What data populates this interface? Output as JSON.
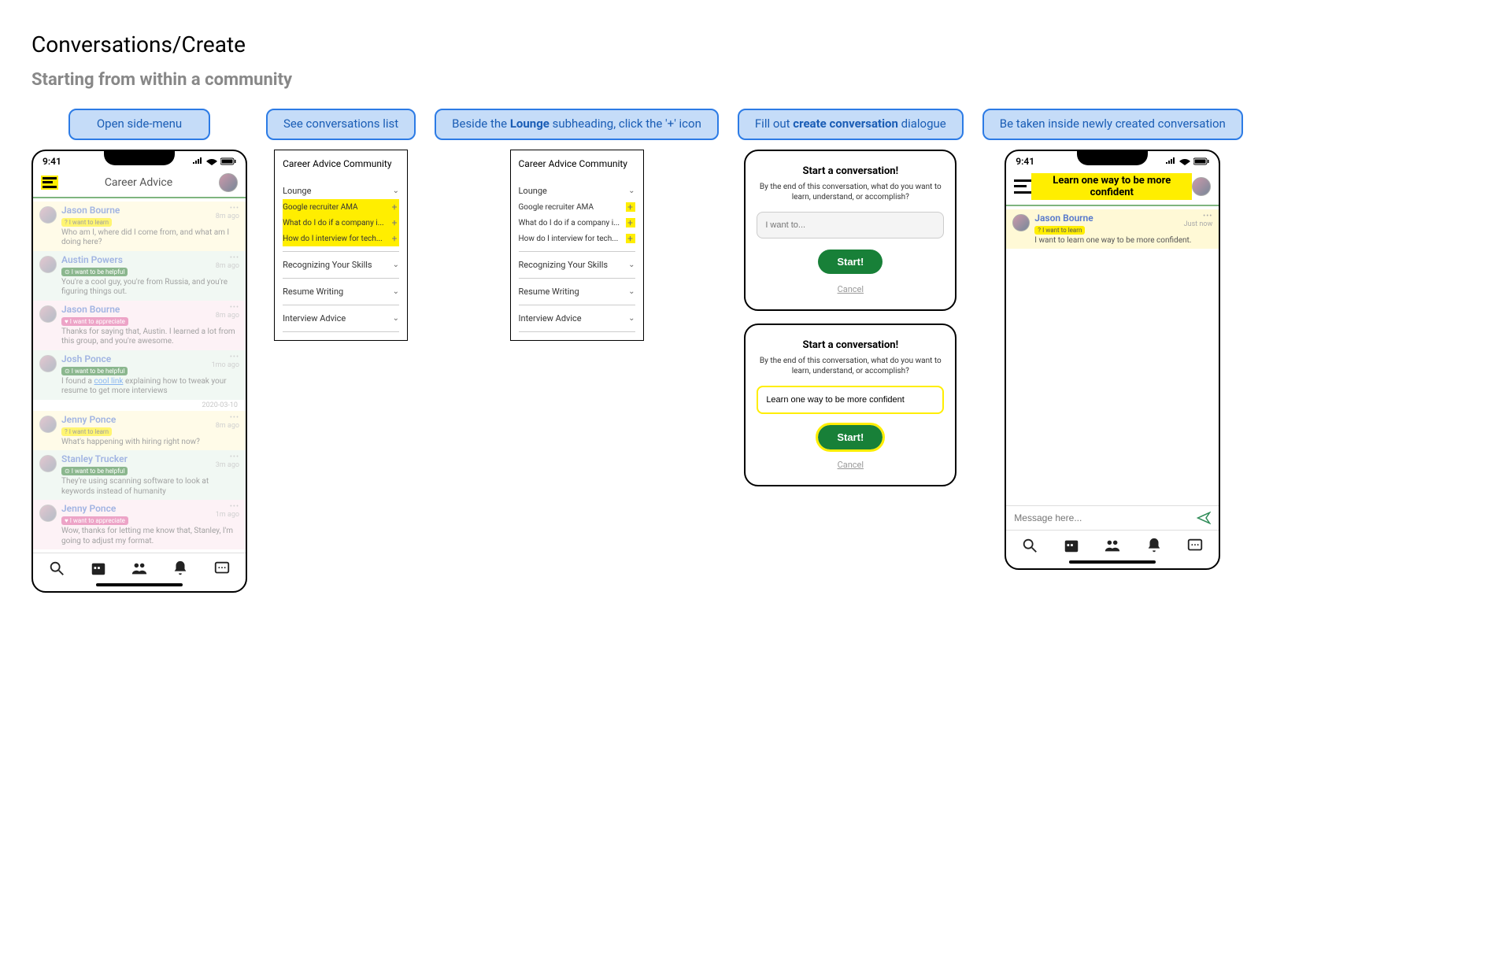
{
  "page": {
    "title": "Conversations/Create",
    "subtitle": "Starting from within a community"
  },
  "steps": [
    {
      "label": "Open side-menu"
    },
    {
      "label_html": "See conversations list"
    },
    {
      "label_html": "Beside the <b>Lounge</b> subheading, click the '+' icon"
    },
    {
      "label_html": "Fill out <b>create conversation</b> dialogue"
    },
    {
      "label_html": "Be taken inside newly created conversation"
    }
  ],
  "statusbar": {
    "time": "9:41"
  },
  "screen1": {
    "header_title": "Career Advice",
    "date_divider": "2020-03-10",
    "input_placeholder": "Message here...",
    "messages": [
      {
        "name": "Jason Bourne",
        "tag": "? I want to learn",
        "tag_class": "tag-learn",
        "text": "Who am I, where did I come from, and what am I doing here?",
        "time": "8m ago",
        "bg": "yellow"
      },
      {
        "name": "Austin Powers",
        "tag": "⊙ I want to be helpful",
        "tag_class": "tag-helpful",
        "text": "You're a cool guy, you're from Russia, and you're figuring things out.",
        "time": "8m ago",
        "bg": "green"
      },
      {
        "name": "Jason Bourne",
        "tag": "♥ I want to appreciate",
        "tag_class": "tag-appreciate",
        "text": "Thanks for saying that, Austin. I learned a lot from this group, and you're awesome.",
        "time": "8m ago",
        "bg": "pink"
      },
      {
        "name": "Josh Ponce",
        "tag": "⊙ I want to be helpful",
        "tag_class": "tag-helpful",
        "text": "I found a <a href='#'>cool link</a> explaining how to tweak your resume to get more interviews",
        "time": "1mo ago",
        "bg": "green"
      },
      {
        "name": "Jenny Ponce",
        "tag": "? I want to learn",
        "tag_class": "tag-learn",
        "text": "What's happening with hiring right now?",
        "time": "8m ago",
        "bg": "yellow"
      },
      {
        "name": "Stanley Trucker",
        "tag": "⊙ I want to be helpful",
        "tag_class": "tag-helpful",
        "text": "They're using scanning software to look at keywords instead of humanity",
        "time": "3m ago",
        "bg": "green"
      },
      {
        "name": "Jenny Ponce",
        "tag": "♥ I want to appreciate",
        "tag_class": "tag-appreciate",
        "text": "Wow, thanks for letting me know that, Stanley, I'm going to adjust my format.",
        "time": "1m ago",
        "bg": "pink"
      }
    ]
  },
  "panel": {
    "title": "Career Advice Community",
    "sections": [
      {
        "name": "Lounge",
        "expanded": true,
        "items": [
          {
            "label": "Google recruiter AMA"
          },
          {
            "label": "What do I do if a company i..."
          },
          {
            "label": "How do I interview for tech..."
          }
        ]
      },
      {
        "name": "Recognizing Your Skills",
        "expanded": false
      },
      {
        "name": "Resume Writing",
        "expanded": false
      },
      {
        "name": "Interview Advice",
        "expanded": false
      }
    ]
  },
  "dialog": {
    "title": "Start a conversation!",
    "subtitle": "By the end of this conversation, what do you want to learn, understand, or accomplish?",
    "placeholder": "I want to...",
    "filled_value": "Learn one way to be more confident",
    "start_label": "Start!",
    "cancel_label": "Cancel"
  },
  "screen5": {
    "header_title": "Learn one way to be more confident",
    "message": {
      "name": "Jason Bourne",
      "tag": "? I want to learn",
      "text": "I want to learn one way to be more confident.",
      "time": "Just now"
    },
    "input_placeholder": "Message here..."
  }
}
